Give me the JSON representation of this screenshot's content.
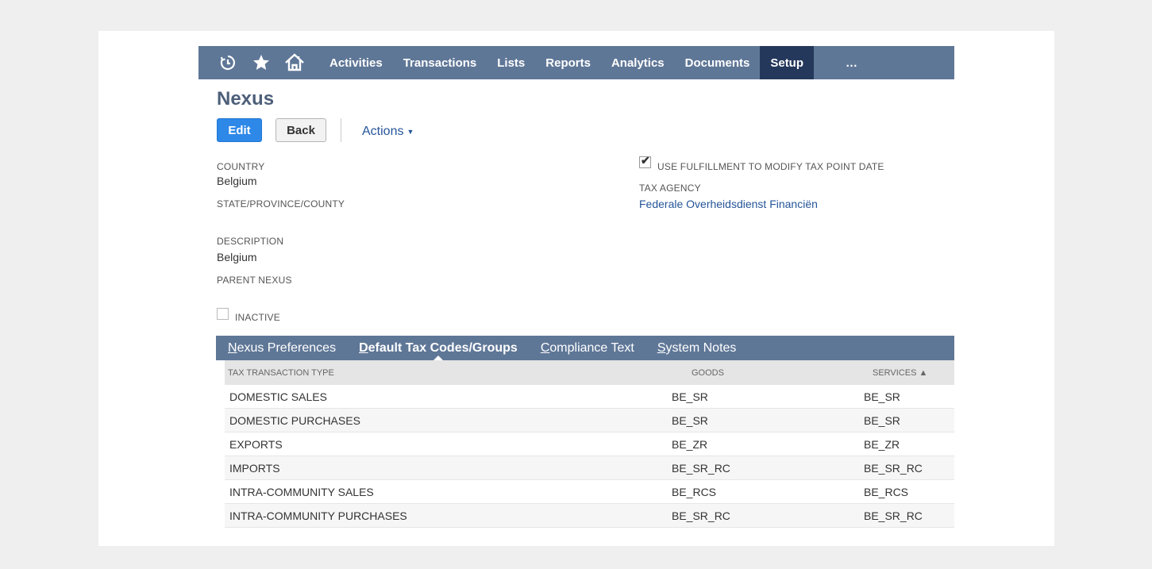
{
  "nav": {
    "icons": [
      "recent-history-icon",
      "star-icon",
      "home-icon"
    ],
    "items": [
      "Activities",
      "Transactions",
      "Lists",
      "Reports",
      "Analytics",
      "Documents",
      "Setup"
    ],
    "active": "Setup",
    "more": "…"
  },
  "page": {
    "title": "Nexus",
    "edit_label": "Edit",
    "back_label": "Back",
    "actions_label": "Actions"
  },
  "fields": {
    "country_label": "COUNTRY",
    "country_value": "Belgium",
    "state_label": "STATE/PROVINCE/COUNTY",
    "description_label": "DESCRIPTION",
    "description_value": "Belgium",
    "parent_label": "PARENT NEXUS",
    "inactive_label": "INACTIVE",
    "inactive_checked": false,
    "fulfillment_label": "USE FULFILLMENT TO MODIFY TAX POINT DATE",
    "fulfillment_checked": true,
    "tax_agency_label": "TAX AGENCY",
    "tax_agency_value": "Federale Overheidsdienst Financiën"
  },
  "subtabs": {
    "nexus_prefs": {
      "underline": "N",
      "rest": "exus Preferences"
    },
    "default_tax": {
      "pre": "",
      "underline": "D",
      "rest": "efault Tax Codes/Groups"
    },
    "compliance": {
      "underline": "C",
      "rest": "ompliance Text"
    },
    "system_notes": {
      "underline": "S",
      "rest": "ystem Notes"
    }
  },
  "table": {
    "headers": {
      "type": "TAX TRANSACTION TYPE",
      "goods": "GOODS",
      "services": "SERVICES ▲"
    },
    "rows": [
      {
        "type": "DOMESTIC SALES",
        "goods": "BE_SR",
        "services": "BE_SR"
      },
      {
        "type": "DOMESTIC PURCHASES",
        "goods": "BE_SR",
        "services": "BE_SR"
      },
      {
        "type": "EXPORTS",
        "goods": "BE_ZR",
        "services": "BE_ZR"
      },
      {
        "type": "IMPORTS",
        "goods": "BE_SR_RC",
        "services": "BE_SR_RC"
      },
      {
        "type": "INTRA-COMMUNITY SALES",
        "goods": "BE_RCS",
        "services": "BE_RCS"
      },
      {
        "type": "INTRA-COMMUNITY PURCHASES",
        "goods": "BE_SR_RC",
        "services": "BE_SR_RC"
      }
    ]
  }
}
